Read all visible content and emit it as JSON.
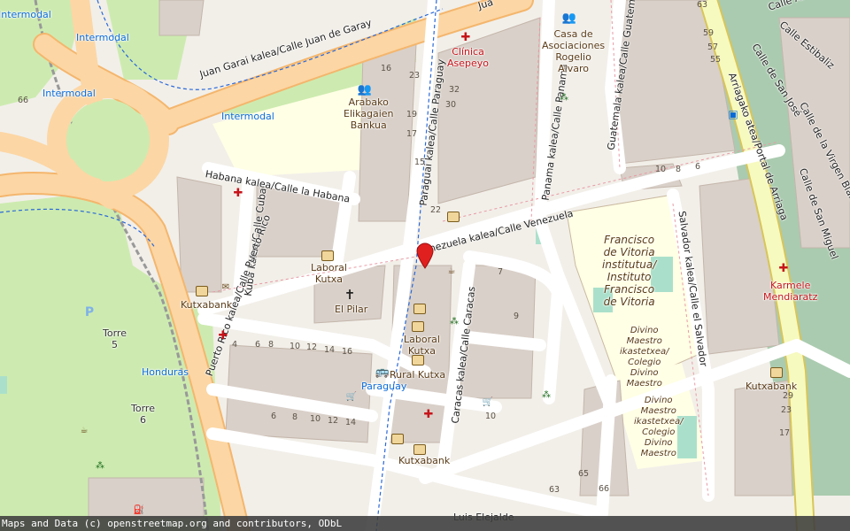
{
  "map": {
    "attribution": "Maps and Data (c) openstreetmap.org and contributors, ODbL",
    "marker_color": "#e0201f",
    "colors": {
      "background": "#f2efe9",
      "park": "#c8facc",
      "school": "#ffffe5",
      "trunk": "#fcd6a4",
      "primary": "#f7fabf",
      "building": "#d9d0c9",
      "cemetery": "#aacbaf"
    }
  },
  "streets": {
    "juan_garay": "Juan Garai kalea/Calle Juan de Garay",
    "habana": "Habana kalea/Calle la Habana",
    "cuba": "Kuba kalea/Calle Cuba",
    "paraguay": "Paraguai kalea/Calle Paraguay",
    "panama": "Panama kalea/Calle Panamá",
    "guatemala": "Guatemala kalea/Calle Guatemala",
    "venezuela": "Venezuela kalea/Calle Venezuela",
    "puerto_rico": "Puerto Rico kalea/Calle Puerto Rico",
    "caracas": "Caracas kalea/Calle Caracas",
    "salvador": "Salvador kalea/Calle el Salvador",
    "portal_arriaga": "Arriagako atea/Portal de Arriaga",
    "san_jose": "Calle de San José",
    "estibaliz": "Calle Estibaliz",
    "aranzazu": "Calle Aránzazu",
    "virgen_blanca": "Calle de la Virgen Blanca",
    "san_miguel": "Calle de San Miguel",
    "luis_elejalde": "Luis Elejalde"
  },
  "places": {
    "intermodal_1": "Intermodal",
    "intermodal_2": "Intermodal",
    "intermodal_3": "Intermodal",
    "intermodal_4": "Intermodal",
    "clinica": "Clínica\nAsepeyo",
    "asociaciones": "Casa de\nAsociaciones\nRogelio\nAlvaro",
    "arabako": "Arabako\nElikagaien\nBankua",
    "laboral_kutxa_1": "Laboral\nKutxa",
    "laboral_kutxa_2": "Laboral\nKutxa",
    "el_pilar": "El Pilar",
    "kutxabank_1": "Kutxabank",
    "kutxabank_2": "Kutxabank",
    "kutxabank_3": "Kutxabank",
    "torre5": "Torre\n5",
    "torre6": "Torre\n6",
    "honduras": "Honduras",
    "paraguay_stop": "Paraguay",
    "rural_kutxa": "Rural Kutxa",
    "francisco": "Francisco\nde Vitoria\ninstitutua/\nInstituto\nFrancisco\nde Vitoria",
    "divino_1": "Divino\nMaestro\nikastetxea/\nColegio\nDivino\nMaestro",
    "divino_2": "Divino\nMaestro\nikastetxea/\nColegio\nDivino\nMaestro",
    "karmele": "Karmele\nMendiaratz",
    "juan_fragment": "Jua"
  }
}
